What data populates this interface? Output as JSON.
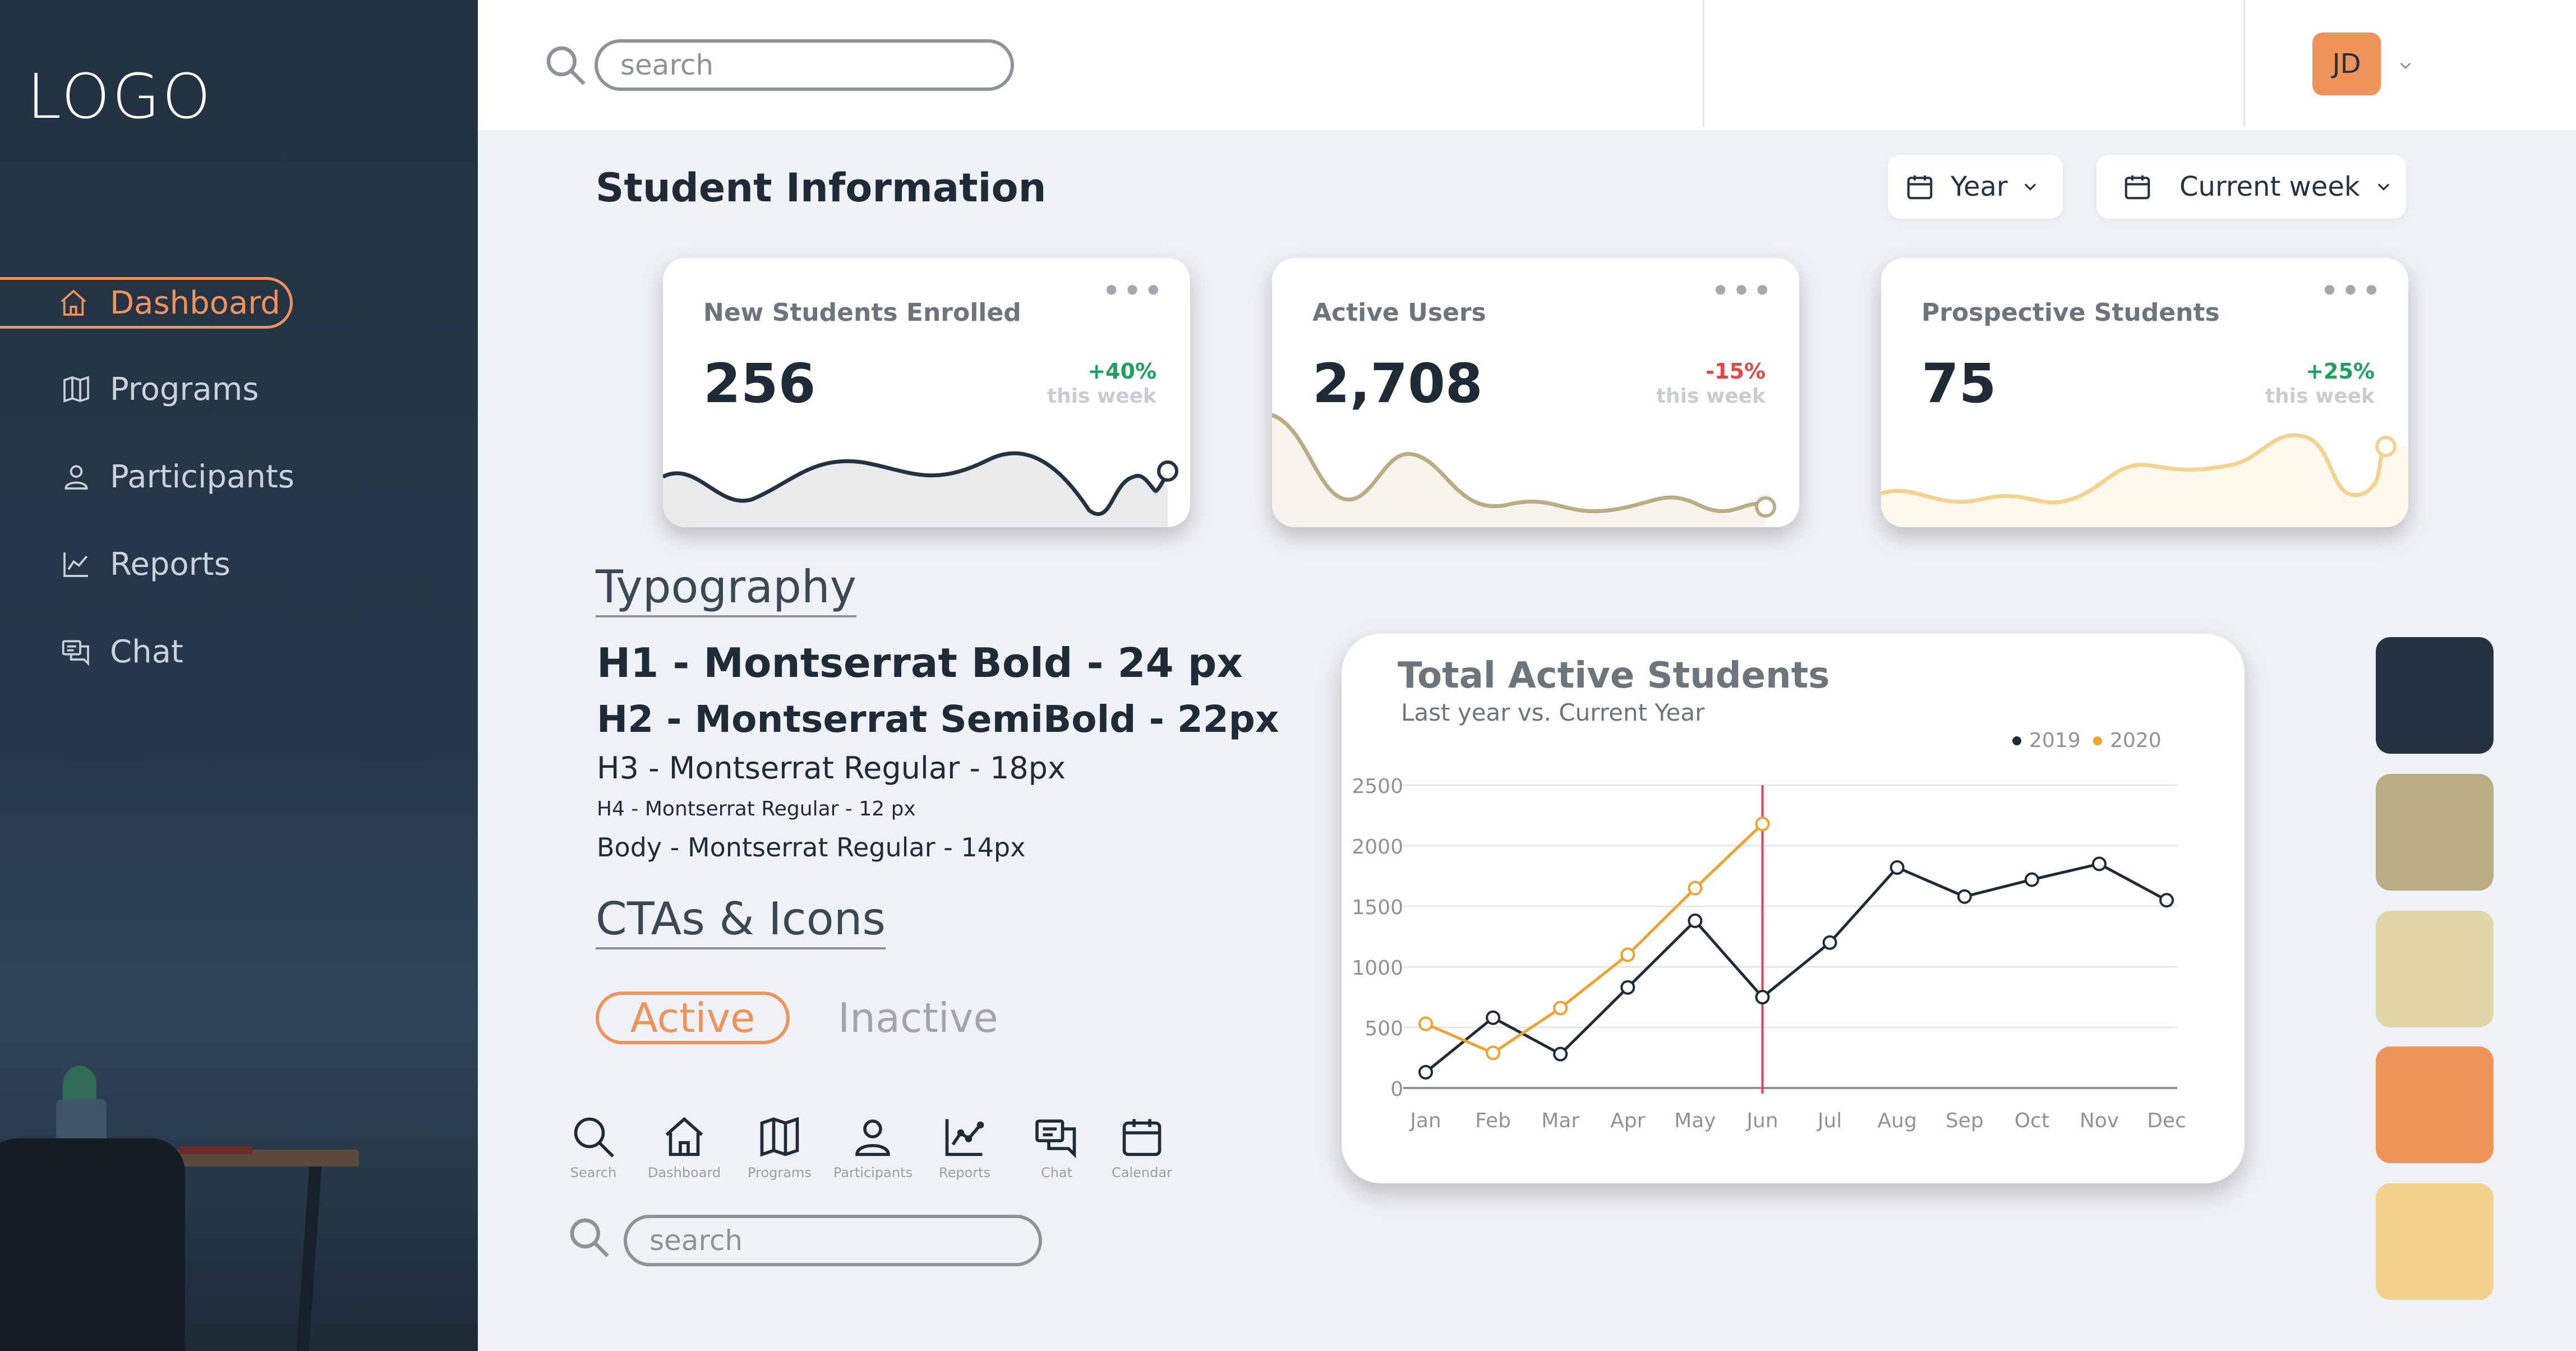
{
  "brand": {
    "logo_text": "LOGO"
  },
  "sidebar": {
    "items": [
      {
        "label": "Dashboard",
        "icon": "home-icon",
        "active": true
      },
      {
        "label": "Programs",
        "icon": "map-icon",
        "active": false
      },
      {
        "label": "Participants",
        "icon": "user-icon",
        "active": false
      },
      {
        "label": "Reports",
        "icon": "chart-line-icon",
        "active": false
      },
      {
        "label": "Chat",
        "icon": "chat-icon",
        "active": false
      }
    ]
  },
  "header": {
    "search_placeholder": "search",
    "avatar_initials": "JD"
  },
  "page": {
    "title": "Student Information",
    "filters": [
      {
        "label": "Year",
        "icon": "calendar-icon"
      },
      {
        "label": "Current week",
        "icon": "calendar-icon"
      }
    ]
  },
  "cards": [
    {
      "title": "New Students Enrolled",
      "value": "256",
      "change": "+40%",
      "change_color": "#1aa35a",
      "period": "this week",
      "line_color": "#253240"
    },
    {
      "title": "Active Users",
      "value": "2,708",
      "change": "-15%",
      "change_color": "#e04848",
      "period": "this week",
      "line_color": "#b8ad84"
    },
    {
      "title": "Prospective Students",
      "value": "75",
      "change": "+25%",
      "change_color": "#1aa35a",
      "period": "this week",
      "line_color": "#f2d28c"
    }
  ],
  "typography": {
    "heading": "Typography",
    "h1": "H1 - Montserrat Bold - 24 px",
    "h2": "H2 - Montserrat SemiBold - 22px",
    "h3": "H3 - Montserrat Regular - 18px",
    "h4": "H4 - Montserrat Regular - 12 px",
    "body": "Body - Montserrat Regular - 14px"
  },
  "ctas": {
    "heading": "CTAs & Icons",
    "active_label": "Active",
    "inactive_label": "Inactive",
    "icons": [
      {
        "name": "search-icon",
        "label": "Search"
      },
      {
        "name": "home-icon",
        "label": "Dashboard"
      },
      {
        "name": "map-icon",
        "label": "Programs"
      },
      {
        "name": "user-icon",
        "label": "Participants"
      },
      {
        "name": "chart-line-icon",
        "label": "Reports"
      },
      {
        "name": "chat-icon",
        "label": "Chat"
      },
      {
        "name": "calendar-icon",
        "label": "Calendar"
      }
    ],
    "search_placeholder": "search"
  },
  "chart_data": {
    "type": "line",
    "title": "Total Active Students",
    "subtitle": "Last year vs. Current Year",
    "categories": [
      "Jan",
      "Feb",
      "Mar",
      "Apr",
      "May",
      "Jun",
      "Jul",
      "Aug",
      "Sep",
      "Oct",
      "Nov",
      "Dec"
    ],
    "series": [
      {
        "name": "2019",
        "color": "#1f2b37",
        "values": [
          130,
          580,
          280,
          830,
          1380,
          750,
          1200,
          1820,
          1580,
          1720,
          1850,
          1550
        ]
      },
      {
        "name": "2020",
        "color": "#f0a32a",
        "values": [
          530,
          290,
          660,
          1100,
          1650,
          2180
        ]
      }
    ],
    "y_ticks": [
      0,
      500,
      1000,
      1500,
      2000,
      2500
    ],
    "ylim": [
      0,
      2500
    ],
    "marker_month": "Jun",
    "marker_color": "#e0405a",
    "grid": true,
    "legend": "top-right"
  },
  "palette": [
    "#253240",
    "#b8ad84",
    "#e0d6aa",
    "#f0935a",
    "#f2d28c"
  ]
}
